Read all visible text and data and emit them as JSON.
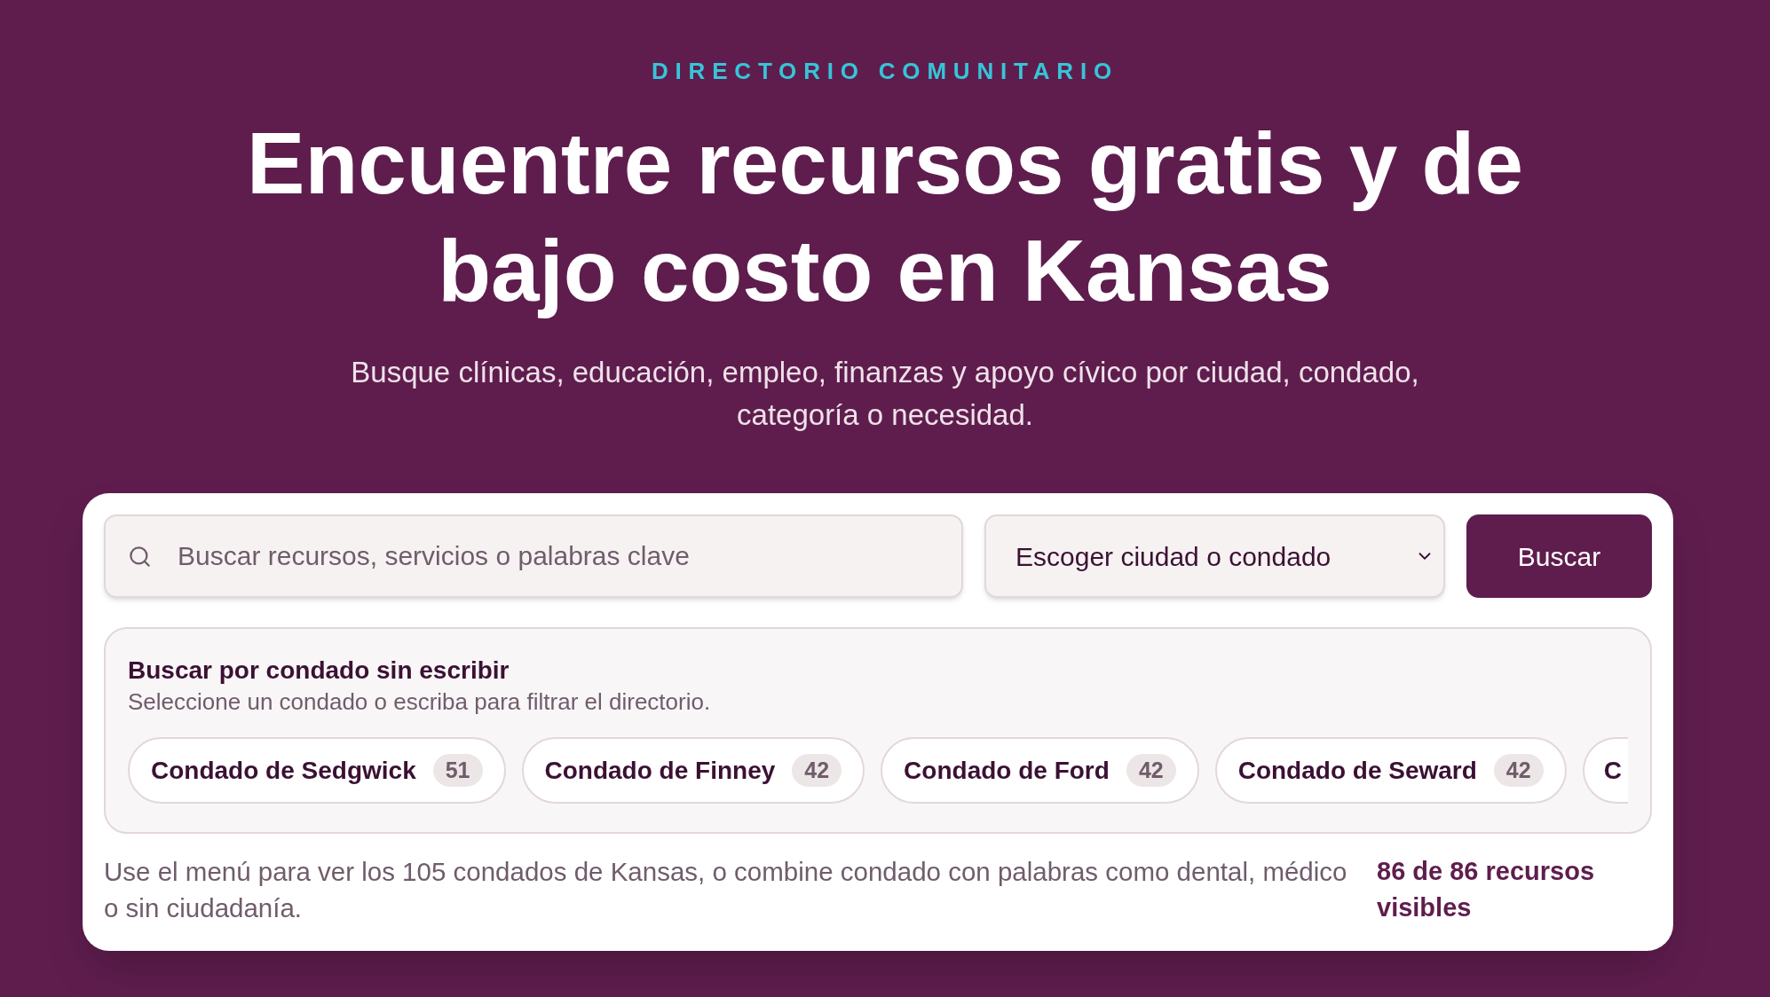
{
  "eyebrow": "DIRECTORIO COMUNITARIO",
  "title": "Encuentre recursos gratis y de bajo costo en Kansas",
  "subtitle": "Busque clínicas, educación, empleo, finanzas y apoyo cívico por ciudad, condado, categoría o necesidad.",
  "search": {
    "placeholder": "Buscar recursos, servicios o palabras clave"
  },
  "location_select": {
    "value": "Escoger ciudad o condado"
  },
  "search_button": "Buscar",
  "county_panel": {
    "title": "Buscar por condado sin escribir",
    "hint": "Seleccione un condado o escriba para filtrar el directorio.",
    "counties": [
      {
        "label": "Condado de Sedgwick",
        "count": "51"
      },
      {
        "label": "Condado de Finney",
        "count": "42"
      },
      {
        "label": "Condado de Ford",
        "count": "42"
      },
      {
        "label": "Condado de Seward",
        "count": "42"
      },
      {
        "label": "C"
      }
    ]
  },
  "footer": {
    "help_text": "Use el menú para ver los 105 condados de Kansas, o combine condado con palabras como dental, médico o sin ciudadanía.",
    "result_count": "86 de 86 recursos visibles"
  }
}
